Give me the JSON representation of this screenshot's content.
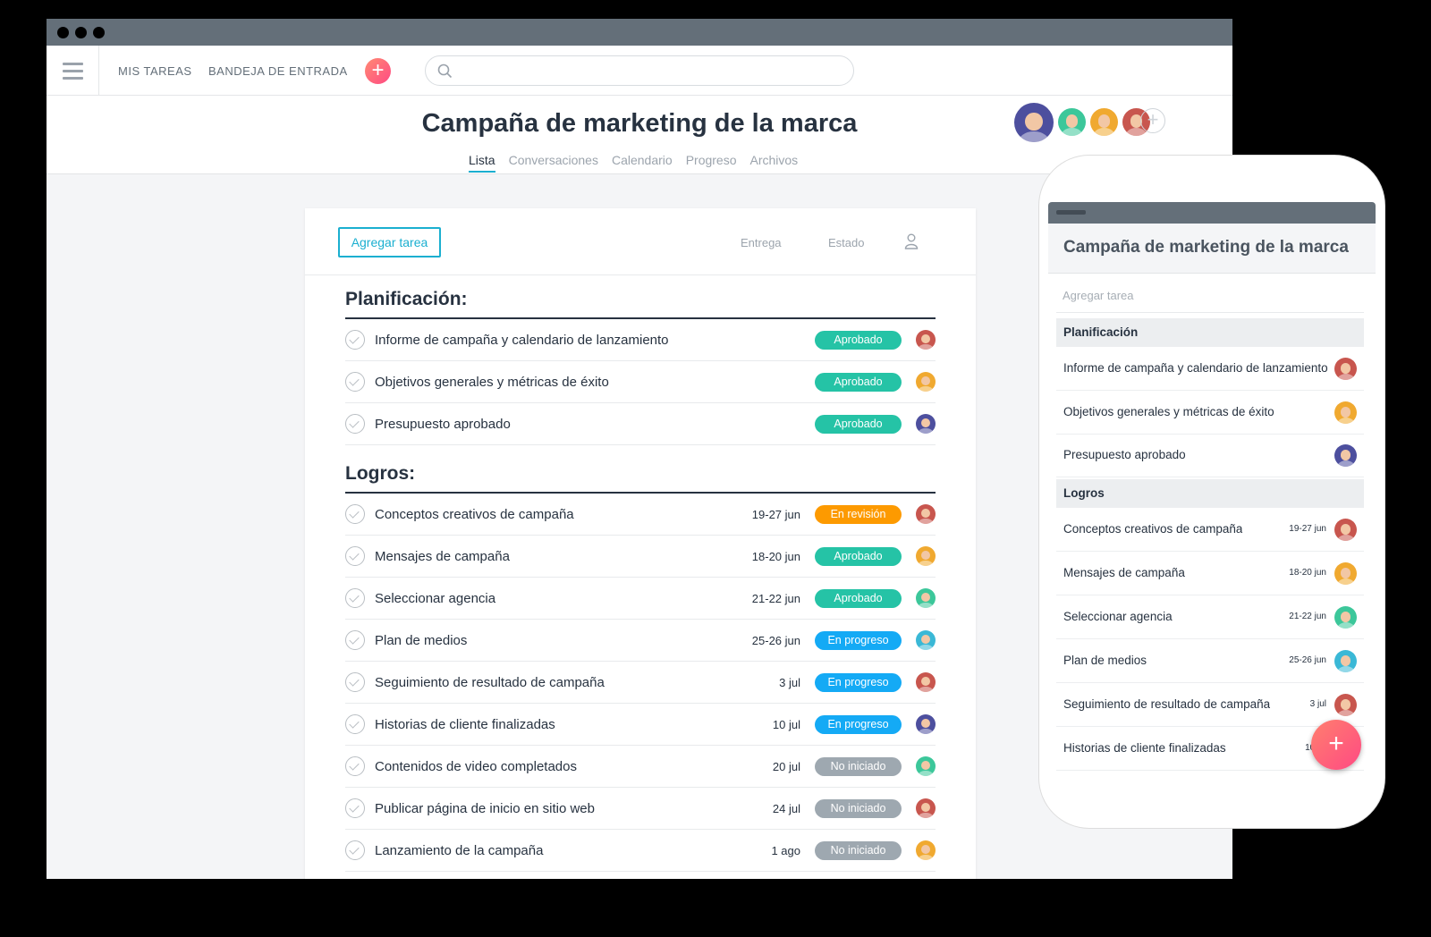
{
  "nav": {
    "my_tasks": "MIS TAREAS",
    "inbox": "BANDEJA DE ENTRADA"
  },
  "project": {
    "title": "Campaña de marketing de la marca"
  },
  "tabs": [
    "Lista",
    "Conversaciones",
    "Calendario",
    "Progreso",
    "Archivos"
  ],
  "list": {
    "add_task_label": "Agregar tarea",
    "col_due": "Entrega",
    "col_status": "Estado"
  },
  "status_colors": {
    "Aprobado": "#25c3a6",
    "En revisión": "#fd9a00",
    "En progreso": "#14aaf5",
    "No iniciado": "#9ea8b0"
  },
  "sections": [
    {
      "title": "Planificación:",
      "tasks": [
        {
          "name": "Informe de campaña y calendario de lanzamiento",
          "date": "",
          "status": "Aprobado",
          "avatar": "#c8564e"
        },
        {
          "name": "Objetivos generales y métricas de éxito",
          "date": "",
          "status": "Aprobado",
          "avatar": "#f0a930"
        },
        {
          "name": "Presupuesto aprobado",
          "date": "",
          "status": "Aprobado",
          "avatar": "#4d4f9e"
        }
      ]
    },
    {
      "title": "Logros:",
      "tasks": [
        {
          "name": "Conceptos creativos de campaña",
          "date": "19-27 jun",
          "status": "En revisión",
          "avatar": "#c8564e"
        },
        {
          "name": "Mensajes de campaña",
          "date": "18-20 jun",
          "status": "Aprobado",
          "avatar": "#f0a930"
        },
        {
          "name": "Seleccionar agencia",
          "date": "21-22 jun",
          "status": "Aprobado",
          "avatar": "#3cc79a"
        },
        {
          "name": "Plan de medios",
          "date": "25-26 jun",
          "status": "En progreso",
          "avatar": "#3ab8d6"
        },
        {
          "name": "Seguimiento de resultado de campaña",
          "date": "3 jul",
          "status": "En progreso",
          "avatar": "#c8564e"
        },
        {
          "name": "Historias de cliente finalizadas",
          "date": "10 jul",
          "status": "En progreso",
          "avatar": "#4d4f9e"
        },
        {
          "name": "Contenidos de video completados",
          "date": "20 jul",
          "status": "No iniciado",
          "avatar": "#3cc79a"
        },
        {
          "name": "Publicar página de inicio en sitio web",
          "date": "24 jul",
          "status": "No iniciado",
          "avatar": "#c8564e"
        },
        {
          "name": "Lanzamiento de la campaña",
          "date": "1 ago",
          "status": "No iniciado",
          "avatar": "#f0a930"
        }
      ]
    }
  ],
  "members": [
    "#4d4f9e",
    "#3cc79a",
    "#f0a930",
    "#c8564e"
  ],
  "mobile": {
    "title": "Campaña de marketing de la marca",
    "add_task": "Agregar tarea",
    "sections": [
      {
        "title": "Planificación",
        "tasks": [
          {
            "name": "Informe de campaña y calendario de lanzamiento",
            "date": "",
            "avatar": "#c8564e"
          },
          {
            "name": "Objetivos generales y métricas de éxito",
            "date": "",
            "avatar": "#f0a930"
          },
          {
            "name": "Presupuesto aprobado",
            "date": "",
            "avatar": "#4d4f9e"
          }
        ]
      },
      {
        "title": "Logros",
        "tasks": [
          {
            "name": "Conceptos creativos de campaña",
            "date": "19-27 jun",
            "avatar": "#c8564e"
          },
          {
            "name": "Mensajes de campaña",
            "date": "18-20 jun",
            "avatar": "#f0a930"
          },
          {
            "name": "Seleccionar agencia",
            "date": "21-22 jun",
            "avatar": "#3cc79a"
          },
          {
            "name": "Plan de medios",
            "date": "25-26 jun",
            "avatar": "#3ab8d6"
          },
          {
            "name": "Seguimiento de resultado de campaña",
            "date": "3 jul",
            "avatar": "#c8564e"
          },
          {
            "name": "Historias de cliente finalizadas",
            "date": "10 jul",
            "avatar": "#4d4f9e"
          }
        ]
      }
    ]
  }
}
